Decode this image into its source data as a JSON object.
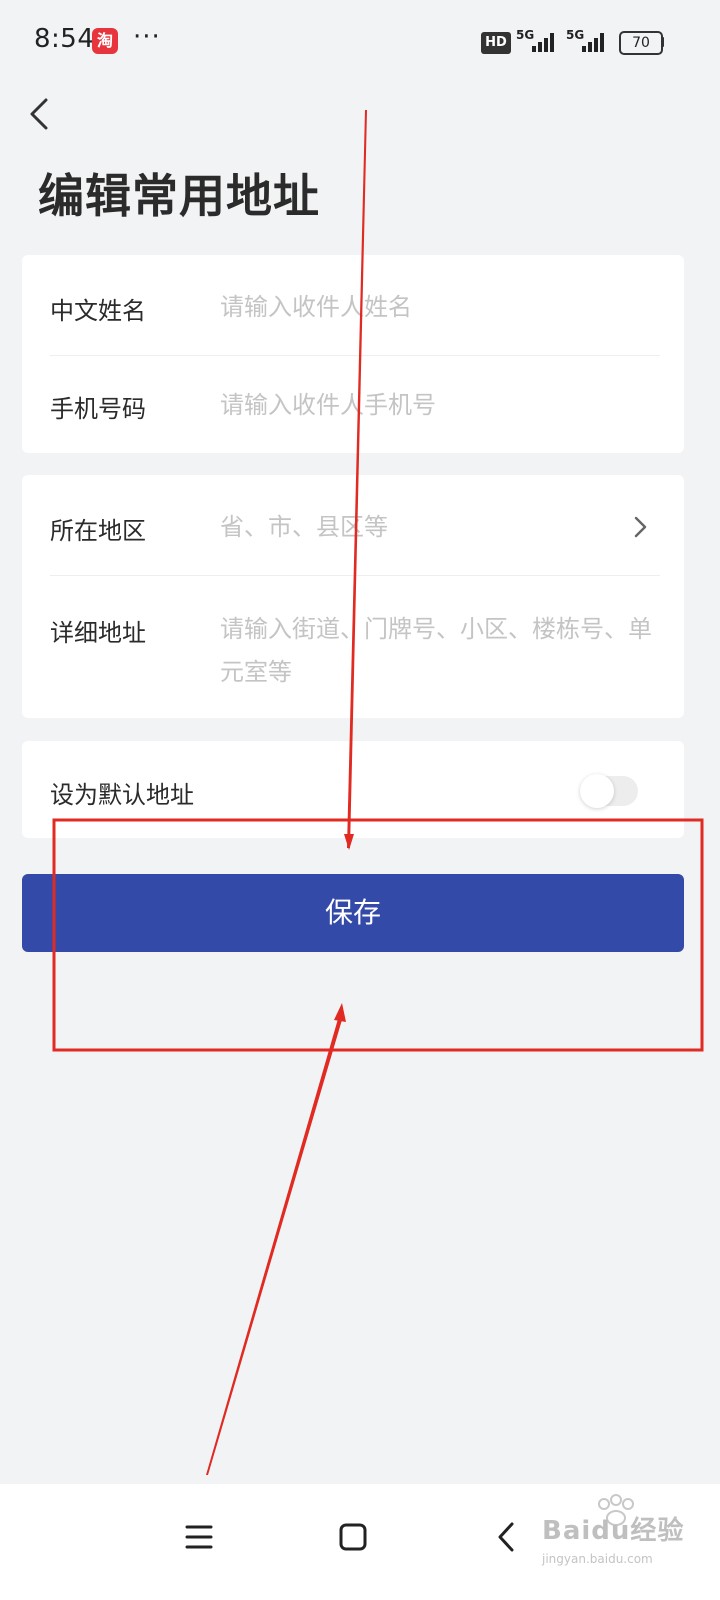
{
  "status_bar": {
    "time": "8:54",
    "app_icon_glyph": "淘",
    "more": "···",
    "hd_badge": "HD",
    "signal_1_label": "5G",
    "signal_2_label": "5G",
    "battery": "70"
  },
  "header": {
    "title": "编辑常用地址"
  },
  "contact_card": {
    "name_label": "中文姓名",
    "name_placeholder": "请输入收件人姓名",
    "phone_label": "手机号码",
    "phone_placeholder": "请输入收件人手机号"
  },
  "address_card": {
    "region_label": "所在地区",
    "region_placeholder": "省、市、县区等",
    "detail_label": "详细地址",
    "detail_placeholder": "请输入街道、门牌号、小区、楼栋号、单元室等"
  },
  "default_card": {
    "label": "设为默认地址",
    "toggle_on": false
  },
  "save_button": {
    "label": "保存"
  },
  "watermark": {
    "brand": "Baidu经验",
    "site": "jingyan.baidu.com"
  },
  "colors": {
    "primary": "#344aa8",
    "annotation": "#e02a22",
    "background": "#f2f3f5"
  }
}
